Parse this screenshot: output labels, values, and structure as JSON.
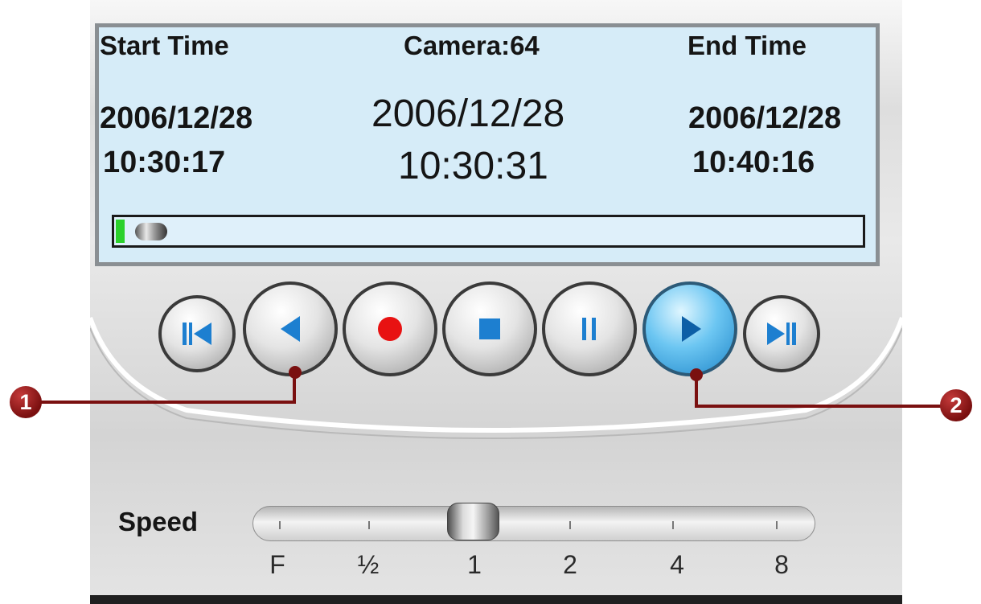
{
  "display": {
    "start_label": "Start Time",
    "camera_label": "Camera:64",
    "end_label": "End Time",
    "start_date": "2006/12/28",
    "start_time": "10:30:17",
    "current_date": "2006/12/28",
    "current_time": "10:30:31",
    "end_date": "2006/12/28",
    "end_time": "10:40:16",
    "playback_progress": 0.02
  },
  "controls": [
    {
      "name": "skip-to-start",
      "icon": "skip-back-icon"
    },
    {
      "name": "reverse-play",
      "icon": "play-reverse-icon"
    },
    {
      "name": "record",
      "icon": "record-icon"
    },
    {
      "name": "stop",
      "icon": "stop-icon"
    },
    {
      "name": "pause",
      "icon": "pause-icon"
    },
    {
      "name": "play",
      "icon": "play-icon"
    },
    {
      "name": "skip-to-end",
      "icon": "skip-forward-icon"
    }
  ],
  "callouts": {
    "one": "1",
    "two": "2"
  },
  "speed": {
    "label": "Speed",
    "options": [
      "F",
      "½",
      "1",
      "2",
      "4",
      "8"
    ],
    "selected": "1"
  },
  "colors": {
    "screen_bg": "#d6ecf8",
    "progress_green": "#2bd12b",
    "record_red": "#e81212",
    "icon_blue": "#1d7fd0",
    "callout_red": "#7a1010"
  }
}
